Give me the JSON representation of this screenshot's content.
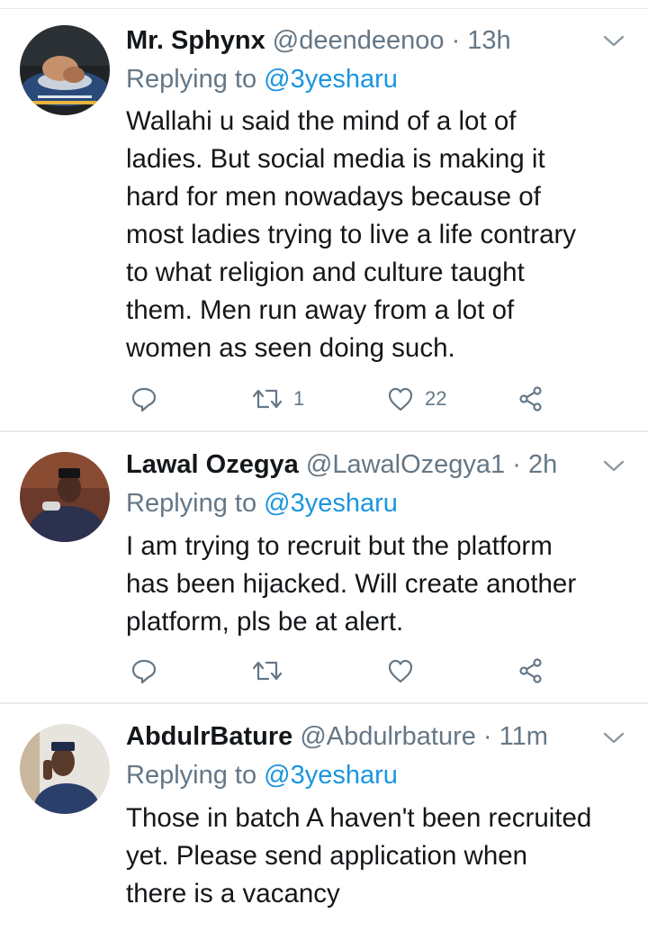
{
  "tweets": [
    {
      "name": "Mr. Sphynx",
      "handle": "@deendeenoo",
      "sep": "·",
      "time": "13h",
      "reply_prefix": "Replying to",
      "reply_handle": "@3yesharu",
      "text_lines": [
        "Wallahi u said the mind of a lot of",
        "ladies. But social media is making it",
        "hard for men nowadays because of",
        "most ladies trying to live a life contrary",
        "to what religion and culture taught",
        "them. Men run away from a lot of",
        "women as seen doing such."
      ],
      "replies": "",
      "retweets": "1",
      "likes": "22",
      "avatar_icon": "wrestling-photo-avatar"
    },
    {
      "name": "Lawal Ozegya",
      "handle": "@LawalOzegya1",
      "sep": "·",
      "time": "2h",
      "reply_prefix": "Replying to",
      "reply_handle": "@3yesharu",
      "text_lines": [
        "I am trying to recruit but the platform",
        "has been hijacked. Will create another",
        "platform, pls be at alert."
      ],
      "replies": "",
      "retweets": "",
      "likes": "",
      "avatar_icon": "man-in-cap-avatar"
    },
    {
      "name": "AbdulrBature",
      "handle": "@Abdulrbature",
      "sep": "·",
      "time": "11m",
      "reply_prefix": "Replying to",
      "reply_handle": "@3yesharu",
      "text_lines": [
        "Those in batch A haven't been recruited",
        "yet. Please send application when",
        "there is a vacancy"
      ],
      "avatar_icon": "man-portrait-avatar"
    }
  ],
  "colors": {
    "text": "#14171a",
    "secondary": "#657786",
    "link": "#1b95e0",
    "divider": "#e6ecf0"
  },
  "icons": [
    "reply-icon",
    "retweet-icon",
    "like-icon",
    "share-icon",
    "chevron-down-icon"
  ]
}
